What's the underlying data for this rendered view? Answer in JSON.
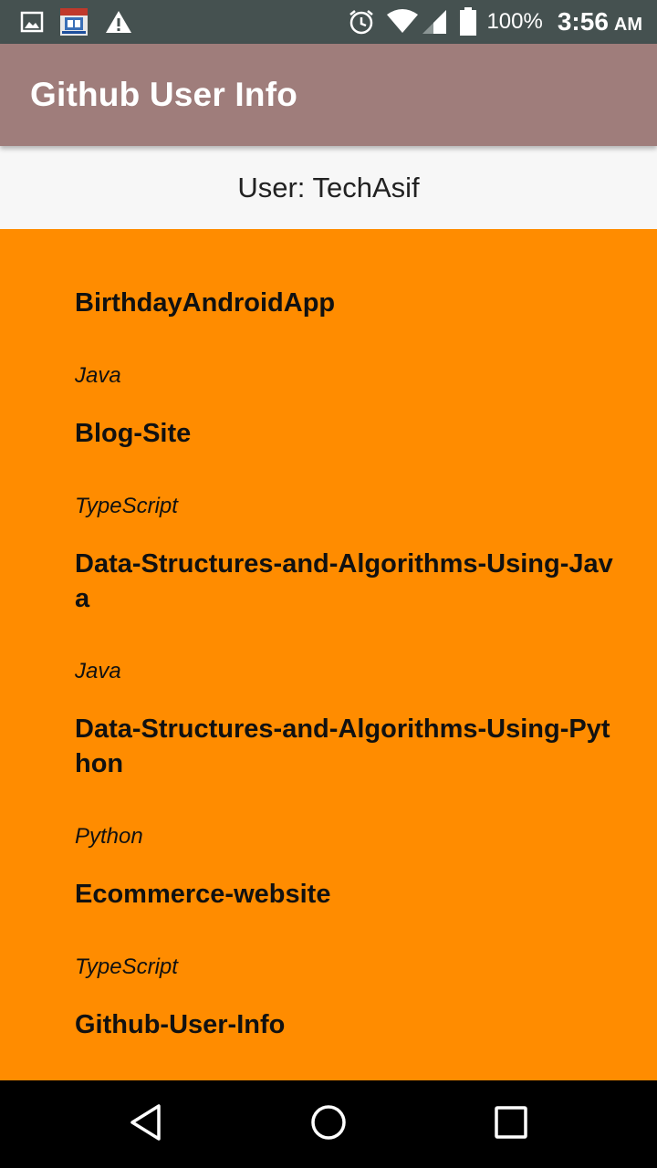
{
  "status_bar": {
    "left_icons": [
      "image-icon",
      "app-notification-icon",
      "warning-icon"
    ],
    "right_icons": [
      "alarm-icon",
      "wifi-icon",
      "signal-icon",
      "battery-icon"
    ],
    "battery": "100%",
    "time": "3:56",
    "ampm": "AM"
  },
  "app_bar": {
    "title": "Github User Info",
    "color": "#9f7d7b"
  },
  "header": {
    "user_label": "User: TechAsif"
  },
  "list": {
    "background": "#ff8c00",
    "repos": [
      {
        "name": "BirthdayAndroidApp",
        "language": "Java"
      },
      {
        "name": "Blog-Site",
        "language": "TypeScript"
      },
      {
        "name": "Data-Structures-and-Algorithms-Using-Java",
        "language": "Java"
      },
      {
        "name": "Data-Structures-and-Algorithms-Using-Python",
        "language": "Python"
      },
      {
        "name": "Ecommerce-website",
        "language": "TypeScript"
      },
      {
        "name": "Github-User-Info",
        "language": ""
      }
    ]
  },
  "nav_bar": {
    "buttons": [
      "back-icon",
      "home-icon",
      "recents-icon"
    ]
  }
}
